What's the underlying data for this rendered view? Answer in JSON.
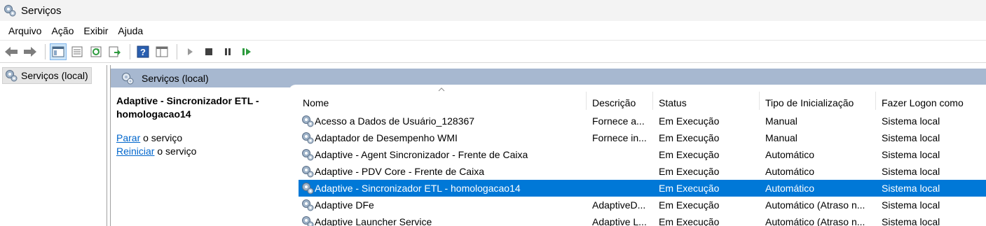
{
  "window": {
    "title": "Serviços",
    "icon": "gear-icon"
  },
  "menu": [
    "Arquivo",
    "Ação",
    "Exibir",
    "Ajuda"
  ],
  "toolbar": {
    "icons": [
      "back-arrow-icon",
      "forward-arrow-icon",
      "show-hide-console-tree-icon",
      "properties-icon",
      "refresh-icon",
      "export-list-icon",
      "help-icon",
      "console-view-icon",
      "start-service-icon",
      "stop-service-icon",
      "pause-service-icon",
      "restart-service-icon"
    ]
  },
  "tree": {
    "root_label": "Serviços (local)"
  },
  "main": {
    "header_label": "Serviços (local)",
    "selected_service_name": "Adaptive - Sincronizador ETL - homologacao14",
    "actions": [
      {
        "link": "Parar",
        "text": " o serviço"
      },
      {
        "link": "Reiniciar",
        "text": " o serviço"
      }
    ]
  },
  "table": {
    "columns": [
      "Nome",
      "Descrição",
      "Status",
      "Tipo de Inicialização",
      "Fazer Logon como"
    ],
    "rows": [
      {
        "name": "Acesso a Dados de Usuário_128367",
        "description": "Fornece a...",
        "status": "Em Execução",
        "startup": "Manual",
        "logon": "Sistema local"
      },
      {
        "name": "Adaptador de Desempenho WMI",
        "description": "Fornece in...",
        "status": "Em Execução",
        "startup": "Manual",
        "logon": "Sistema local"
      },
      {
        "name": "Adaptive - Agent Sincronizador - Frente de Caixa",
        "description": "",
        "status": "Em Execução",
        "startup": "Automático",
        "logon": "Sistema local"
      },
      {
        "name": "Adaptive - PDV Core - Frente de Caixa",
        "description": "",
        "status": "Em Execução",
        "startup": "Automático",
        "logon": "Sistema local"
      },
      {
        "name": "Adaptive - Sincronizador ETL - homologacao14",
        "description": "",
        "status": "Em Execução",
        "startup": "Automático",
        "logon": "Sistema local",
        "selected": true
      },
      {
        "name": "Adaptive DFe",
        "description": "AdaptiveD...",
        "status": "Em Execução",
        "startup": "Automático (Atraso n...",
        "logon": "Sistema local"
      },
      {
        "name": "Adaptive Launcher Service",
        "description": "Adaptive L...",
        "status": "Em Execução",
        "startup": "Automático (Atraso n...",
        "logon": "Sistema local"
      }
    ]
  },
  "colors": {
    "selection": "#0078d7",
    "header_band": "#a7b8d0",
    "link": "#0066cc"
  }
}
